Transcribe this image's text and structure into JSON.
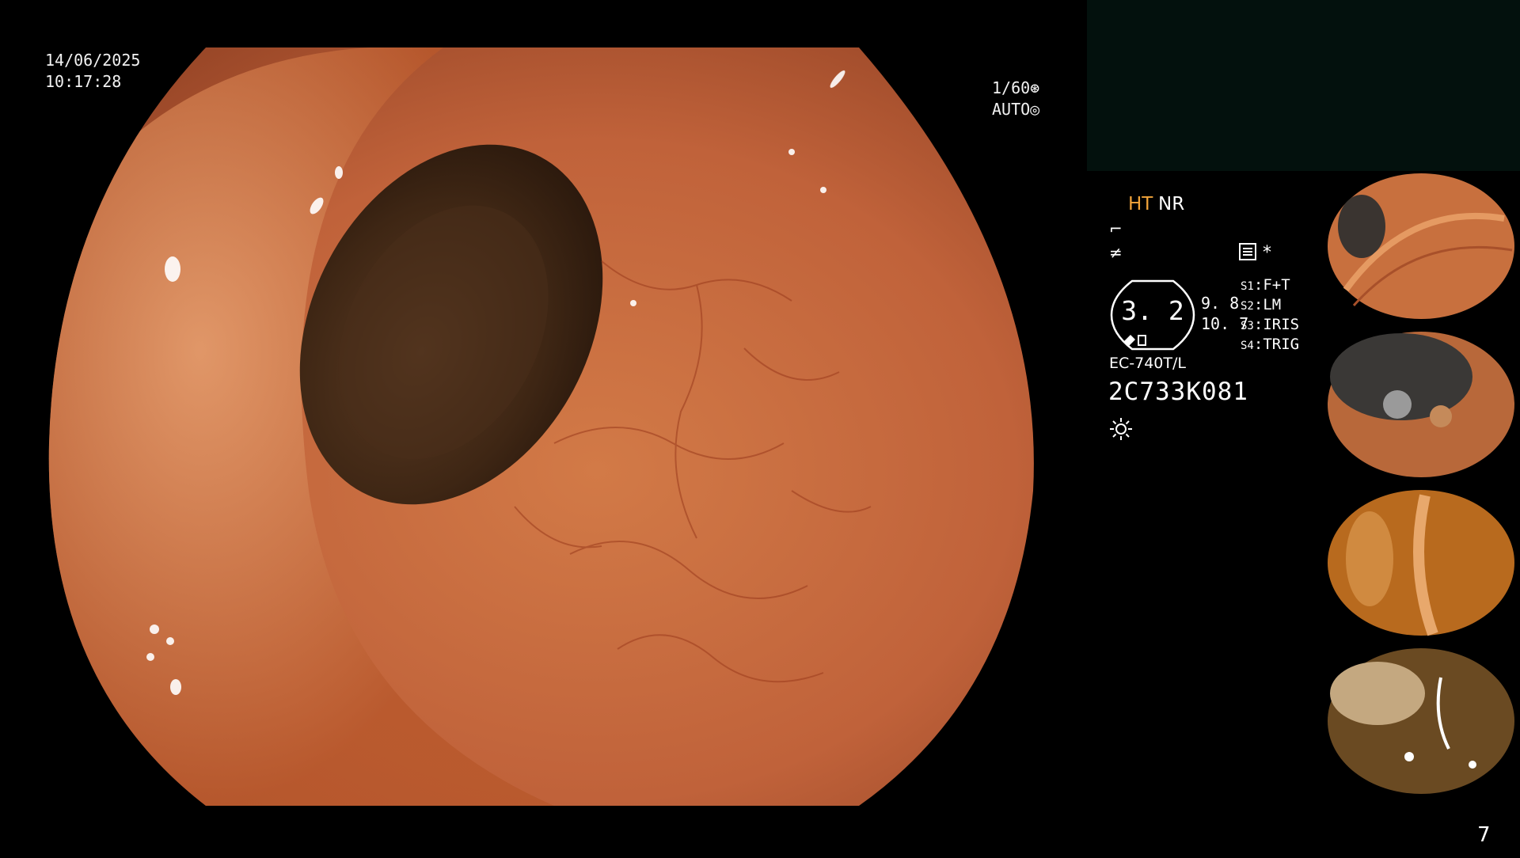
{
  "overlay": {
    "date": "14/06/2025",
    "time": "10:17:28",
    "shutter": "1/60",
    "iris_mode": "AUTO"
  },
  "info": {
    "mode_ht": "HT",
    "mode_nr": "NR",
    "hexagon_value": "3. 2",
    "side_value_1": "9. 8",
    "side_value_2": "10. 7",
    "switches": [
      {
        "key": "S1",
        "value": "F+T"
      },
      {
        "key": "S2",
        "value": "LM"
      },
      {
        "key": "S3",
        "value": "IRIS"
      },
      {
        "key": "S4",
        "value": "TRIG"
      }
    ],
    "scope_model": "EC-740T/L",
    "serial": "2C733K081"
  },
  "thumbnails": [
    {
      "name": "capture-1"
    },
    {
      "name": "capture-2"
    },
    {
      "name": "capture-3"
    },
    {
      "name": "capture-4"
    }
  ],
  "page_number": "7",
  "colors": {
    "mucosa": "#c8683a",
    "lumen": "#3b2414",
    "ht_label": "#f2a43a",
    "top_panel": "#03110d"
  }
}
